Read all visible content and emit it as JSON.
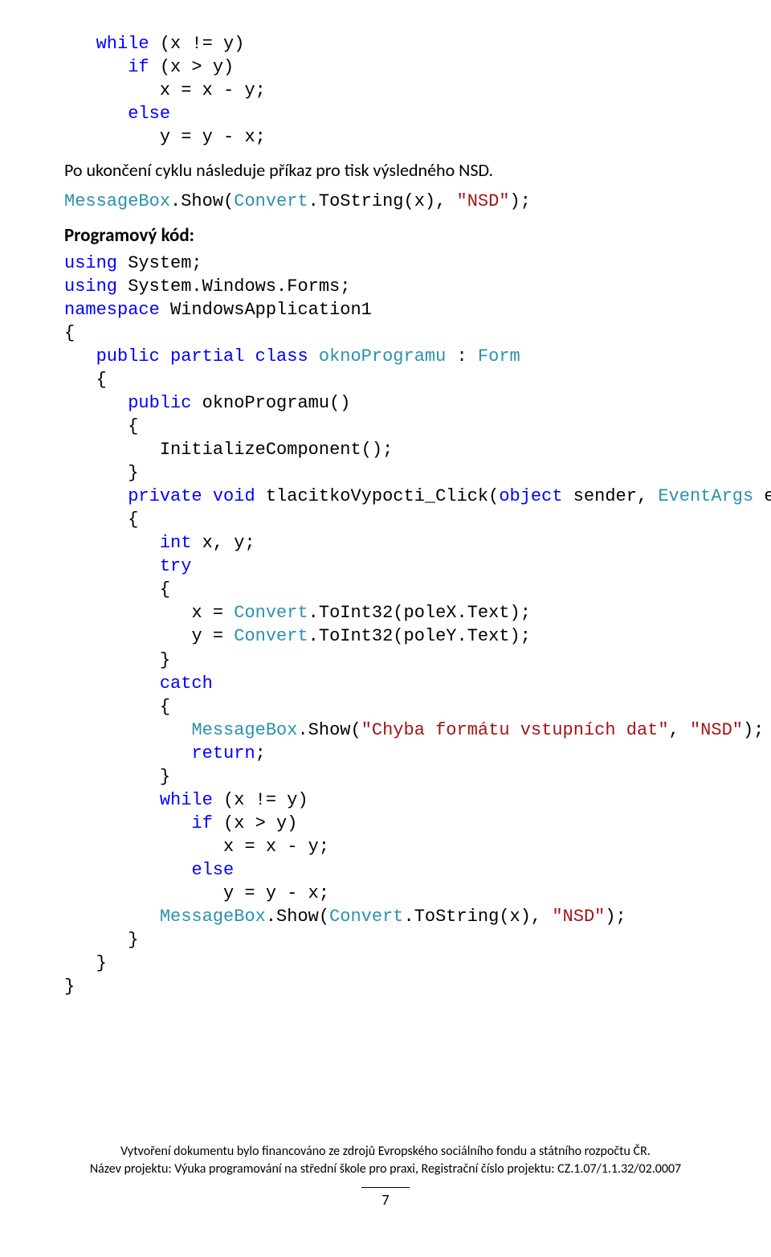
{
  "code_top": {
    "l1_while": "while",
    "l1_rest": " (x != y)",
    "l2_if": "if",
    "l2_rest": " (x > y)",
    "l3": "x = x - y;",
    "l4_else": "else",
    "l5": "y = y - x;"
  },
  "body_text": "Po ukončení cyklu následuje příkaz pro tisk výsledného NSD.",
  "code_mid": {
    "mb": "MessageBox",
    "show": ".Show(",
    "convert": "Convert",
    "tostr": ".ToString(x), ",
    "nsd": "\"NSD\"",
    "end": ");"
  },
  "heading": "Programový kód:",
  "code_main": {
    "using1a": "using",
    "using1b": " System;",
    "using2a": "using",
    "using2b": " System.Windows.Forms;",
    "ns_a": "namespace",
    "ns_b": " WindowsApplication1",
    "ob": "{",
    "cb": "}",
    "pub": "public",
    "partial": " partial ",
    "class": "class",
    "okno_type": "oknoProgramu",
    "colon": " : ",
    "form_type": "Form",
    "ctor_sig": " oknoProgramu()",
    "init": "InitializeComponent();",
    "private": "private",
    "void": "void",
    "click_name": " tlacitkoVypocti_Click(",
    "object": "object",
    "sender": " sender, ",
    "eventargs": "EventArgs",
    "e_close": " e)",
    "int": "int",
    "xy": " x, y;",
    "try": "try",
    "x_eq": "x = ",
    "convert_t": "Convert",
    "toint_x": ".ToInt32(poleX.Text);",
    "y_eq": "y = ",
    "toint_y": ".ToInt32(poleY.Text);",
    "catch": "catch",
    "mb2": "MessageBox",
    "show2": ".Show(",
    "err_str": "\"Chyba formátu vstupních dat\"",
    "comma": ", ",
    "nsd2": "\"NSD\"",
    "end2": ");",
    "return": "return",
    "semi": ";",
    "while": "while",
    "while_cond": " (x != y)",
    "if": "if",
    "if_cond": " (x > y)",
    "xdec": "x = x - y;",
    "else": "else",
    "ydec": "y = y - x;",
    "mb3": "MessageBox",
    "show3": ".Show(",
    "convert3": "Convert",
    "tostr3": ".ToString(x), ",
    "nsd3": "\"NSD\"",
    "end3": ");"
  },
  "footer": {
    "line1": "Vytvoření dokumentu bylo financováno ze zdrojů Evropského sociálního fondu a státního rozpočtu ČR.",
    "line2": "Název projektu: Výuka programování na střední škole pro praxi, Registrační číslo projektu: CZ.1.07/1.1.32/02.0007",
    "page": "7"
  }
}
